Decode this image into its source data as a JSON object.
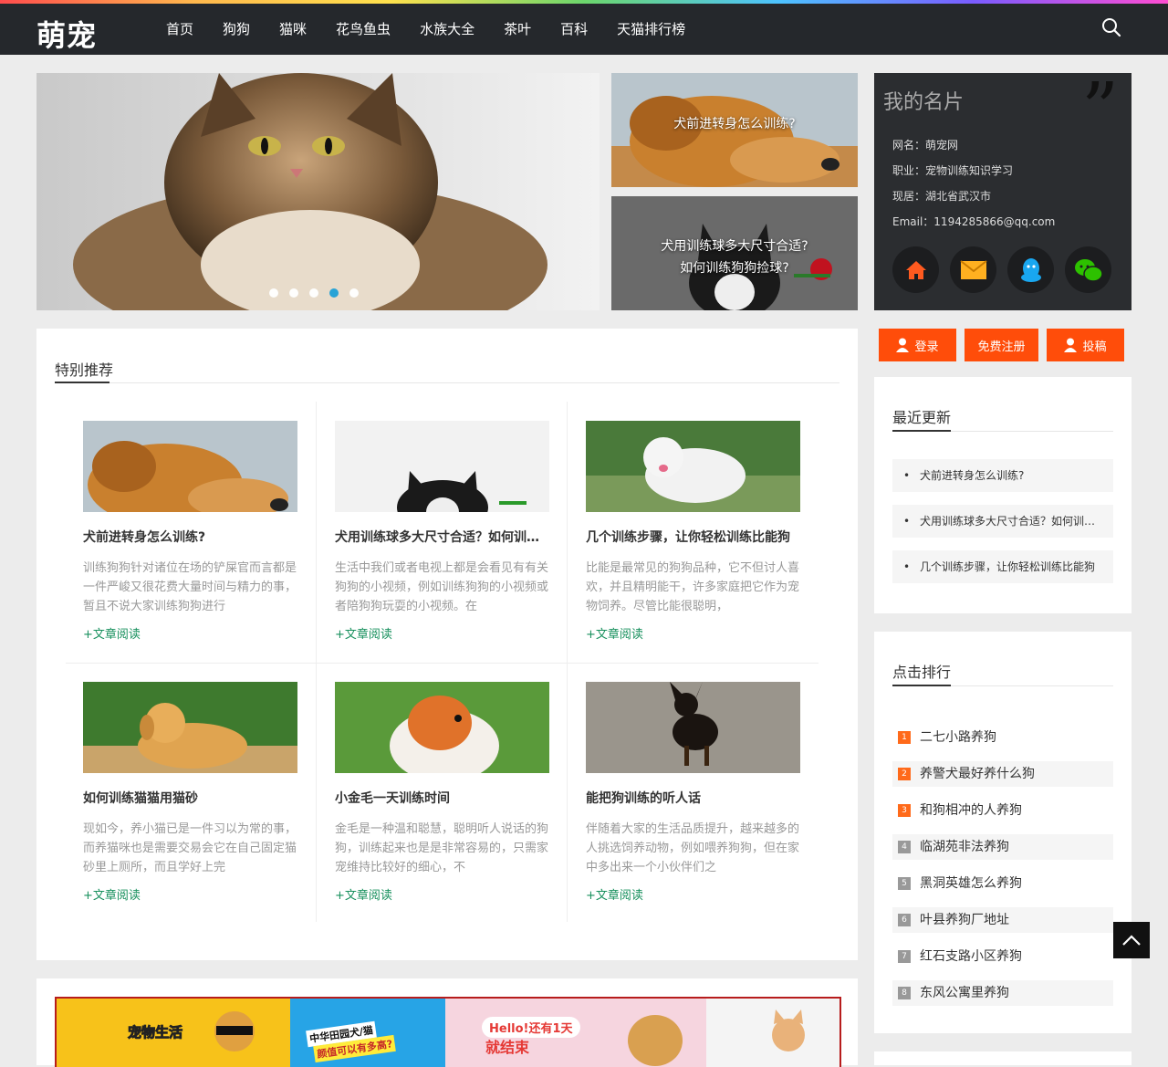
{
  "header": {
    "logo": "萌宠",
    "nav": [
      "首页",
      "狗狗",
      "猫咪",
      "花鸟鱼虫",
      "水族大全",
      "茶叶",
      "百科",
      "天猫排行榜"
    ]
  },
  "hero": {
    "side": [
      {
        "caption": "犬前进转身怎么训练?"
      },
      {
        "caption_line1": "犬用训练球多大尺寸合适?",
        "caption_line2": "如何训练狗狗捡球?"
      }
    ]
  },
  "profile": {
    "title": "我的名片",
    "name": "网名：萌宠网",
    "job": "职业：宠物训练知识学习",
    "location": "现居：湖北省武汉市",
    "email": "Email：1194285866@qq.com"
  },
  "auth": {
    "login": "登录",
    "register": "免费注册",
    "submit": "投稿"
  },
  "featured": {
    "title": "特别推荐",
    "more": "+文章阅读",
    "items": [
      {
        "title": "犬前进转身怎么训练?",
        "desc": "训练狗狗针对诸位在场的铲屎官而言都是一件严峻又很花费大量时间与精力的事，暂且不说大家训练狗狗进行"
      },
      {
        "title": "犬用训练球多大尺寸合适？如何训练狗狗捡球?",
        "desc": "生活中我们或者电视上都是会看见有有关狗狗的小视频，例如训练狗狗的小视频或者陪狗狗玩耍的小视频。在"
      },
      {
        "title": "几个训练步骤，让你轻松训练比能狗",
        "desc": "比能是最常见的狗狗品种，它不但讨人喜欢，并且精明能干，许多家庭把它作为宠物饲养。尽管比能很聪明，"
      },
      {
        "title": "如何训练猫猫用猫砂",
        "desc": "现如今，养小猫已是一件习以为常的事，而养猫咪也是需要交易会它在自己固定猫砂里上厕所，而且学好上完"
      },
      {
        "title": "小金毛一天训练时间",
        "desc": "金毛是一种温和聪慧，聪明听人说话的狗狗，训练起来也是是非常容易的，只需家宠维持比较好的细心，不"
      },
      {
        "title": "能把狗训练的听人话",
        "desc": "伴随着大家的生活品质提升，越来越多的人挑选饲养动物，例如喂养狗狗，但在家中多出来一个小伙伴们之"
      }
    ]
  },
  "latest": {
    "title": "最近更新",
    "items": [
      "犬前进转身怎么训练?",
      "犬用训练球多大尺寸合适？如何训练狗狗捡球?",
      "几个训练步骤，让你轻松训练比能狗"
    ]
  },
  "ranking": {
    "title": "点击排行",
    "items": [
      {
        "n": "1",
        "text": "二七小路养狗"
      },
      {
        "n": "2",
        "text": "养警犬最好养什么狗"
      },
      {
        "n": "3",
        "text": "和狗相冲的人养狗"
      },
      {
        "n": "4",
        "text": "临湖苑非法养狗"
      },
      {
        "n": "5",
        "text": "黑洞英雄怎么养狗"
      },
      {
        "n": "6",
        "text": "叶县养狗厂地址"
      },
      {
        "n": "7",
        "text": "红石支路小区养狗"
      },
      {
        "n": "8",
        "text": "东风公寓里养狗"
      }
    ]
  },
  "banner": {
    "texts": [
      "宠物生活",
      "中华田园犬/猫",
      "颜值可以有多高?",
      "Hello!还有1天",
      "就结束"
    ]
  },
  "colors": {
    "accent": "#ff4d0a",
    "link": "#17905d",
    "dark": "#25282c",
    "dot_active": "#1e9fd6"
  }
}
